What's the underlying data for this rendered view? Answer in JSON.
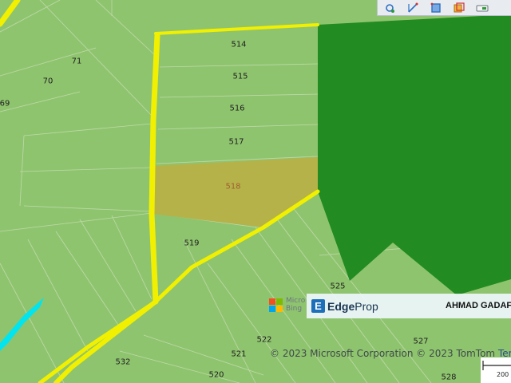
{
  "map": {
    "colors": {
      "land": "#8fc46f",
      "forest": "#228b22",
      "forest_edge": "#8fc46f",
      "road": "#f0f000",
      "selected_lot": "#b5b24a",
      "water": "#00e5f0",
      "parcel_lines": "#c4dcb0"
    },
    "lots": [
      {
        "id": "lot-514",
        "label": "514"
      },
      {
        "id": "lot-515",
        "label": "515"
      },
      {
        "id": "lot-516",
        "label": "516"
      },
      {
        "id": "lot-517",
        "label": "517"
      },
      {
        "id": "lot-518",
        "label": "518",
        "selected": true
      },
      {
        "id": "lot-519",
        "label": "519"
      },
      {
        "id": "lot-525",
        "label": "525"
      },
      {
        "id": "lot-522",
        "label": "522"
      },
      {
        "id": "lot-521",
        "label": "521"
      },
      {
        "id": "lot-532",
        "label": "532"
      },
      {
        "id": "lot-520",
        "label": "520"
      },
      {
        "id": "lot-527",
        "label": "527"
      },
      {
        "id": "lot-528",
        "label": "528"
      },
      {
        "id": "lot-71",
        "label": "71"
      },
      {
        "id": "lot-70",
        "label": "70"
      },
      {
        "id": "lot-69",
        "label": "69"
      }
    ]
  },
  "toolbar": {
    "tools": [
      {
        "icon": "locate-icon"
      },
      {
        "icon": "measure-icon"
      },
      {
        "icon": "area-icon"
      },
      {
        "icon": "layers-icon"
      },
      {
        "icon": "print-icon"
      }
    ]
  },
  "ms_logo": {
    "line1": "Micro",
    "line2": "Bing"
  },
  "banner": {
    "logo_mark": "E",
    "logo_text_bold": "Edge",
    "logo_text_light": "Prop",
    "agent_name": "AHMAD GADAF"
  },
  "copyright": {
    "text": "© 2023 Microsoft Corporation © 2023 TomTom ",
    "link": "Terms"
  },
  "scale": {
    "label": "200"
  }
}
